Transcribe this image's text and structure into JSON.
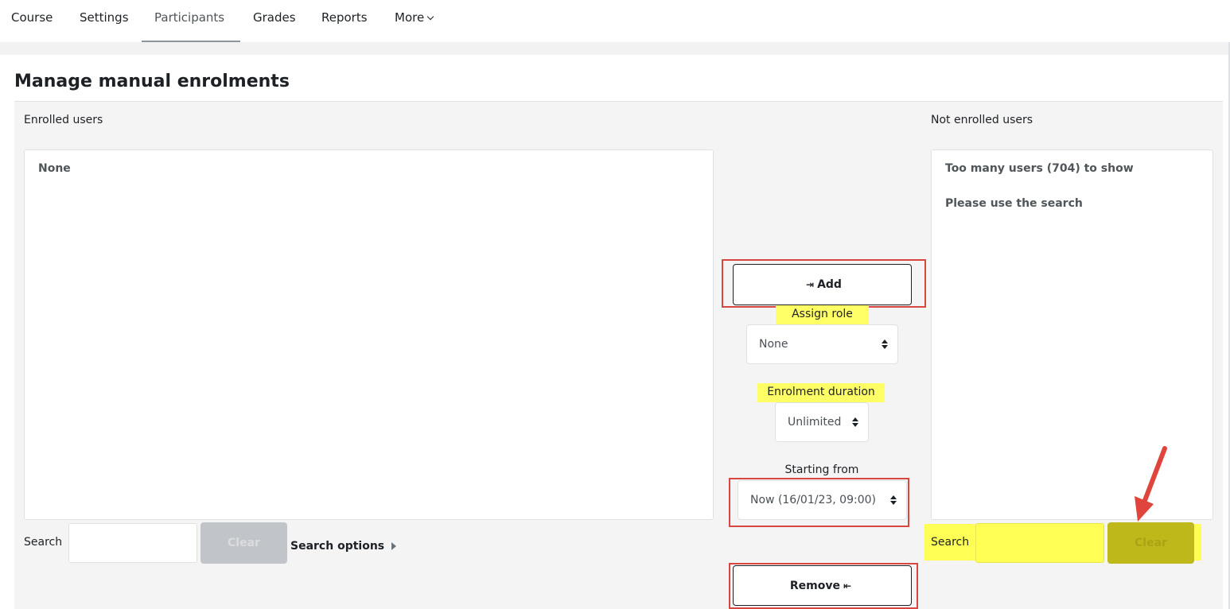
{
  "nav": {
    "items": [
      {
        "label": "Course"
      },
      {
        "label": "Settings"
      },
      {
        "label": "Participants"
      },
      {
        "label": "Grades"
      },
      {
        "label": "Reports"
      },
      {
        "label": "More"
      }
    ],
    "active": "Participants"
  },
  "page": {
    "title": "Manage manual enrolments"
  },
  "enrolled": {
    "label": "Enrolled users",
    "options": [
      "None"
    ],
    "search_label": "Search",
    "search_value": "",
    "clear_label": "Clear",
    "search_options_label": "Search options"
  },
  "not_enrolled": {
    "label": "Not enrolled users",
    "messages": [
      "Too many users (704) to show",
      "Please use the search"
    ],
    "search_label": "Search",
    "search_value": "",
    "clear_label": "Clear"
  },
  "actions": {
    "add_label": "Add",
    "add_icon": "arrow-to-left-icon",
    "remove_label": "Remove",
    "remove_icon": "arrow-to-right-icon",
    "assign_role_label": "Assign role",
    "assign_role_value": "None",
    "duration_label": "Enrolment duration",
    "duration_value": "Unlimited",
    "starting_from_label": "Starting from",
    "starting_from_value": "Now (16/01/23, 09:00)"
  },
  "annotation": {
    "highlight_color": "#ffff55",
    "box_color": "#d9453f",
    "arrow_target": "Clear"
  },
  "colors": {
    "panel_bg": "#f4f4f4",
    "disabled_button": "#c1c4c8"
  }
}
